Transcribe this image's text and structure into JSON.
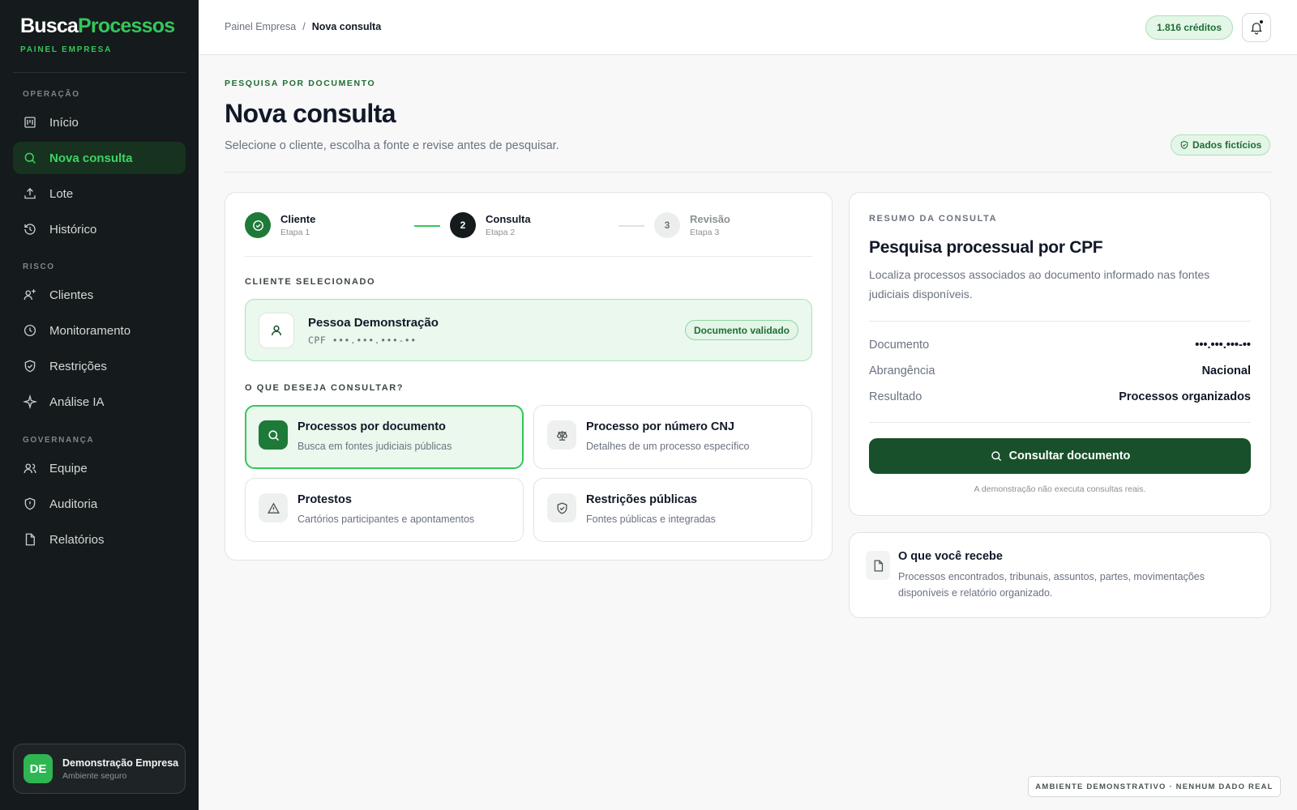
{
  "brand": {
    "part1": "Busca",
    "part2": "Processos",
    "subtitle": "PAINEL EMPRESA"
  },
  "sidebar": {
    "sections": [
      {
        "label": "OPERAÇÃO"
      },
      {
        "label": "RISCO"
      },
      {
        "label": "GOVERNANÇA"
      }
    ],
    "items": [
      {
        "label": "Início",
        "icon": "home-icon"
      },
      {
        "label": "Nova consulta",
        "icon": "search-icon",
        "active": true
      },
      {
        "label": "Lote",
        "icon": "upload-icon"
      },
      {
        "label": "Histórico",
        "icon": "history-icon"
      },
      {
        "label": "Clientes",
        "icon": "user-plus-icon"
      },
      {
        "label": "Monitoramento",
        "icon": "clock-icon"
      },
      {
        "label": "Restrições",
        "icon": "shield-icon"
      },
      {
        "label": "Análise IA",
        "icon": "sparkle-icon"
      },
      {
        "label": "Equipe",
        "icon": "users-icon"
      },
      {
        "label": "Auditoria",
        "icon": "shield-alert-icon"
      },
      {
        "label": "Relatórios",
        "icon": "file-icon"
      }
    ],
    "company": {
      "initials": "DE",
      "name": "Demonstração Empresa",
      "sub": "Ambiente seguro"
    }
  },
  "topbar": {
    "breadcrumb": [
      "Painel Empresa",
      "/",
      "Nova consulta"
    ],
    "credits": "1.816 créditos"
  },
  "header": {
    "eyebrow": "PESQUISA POR DOCUMENTO",
    "title": "Nova consulta",
    "subtitle": "Selecione o cliente, escolha a fonte e revise antes de pesquisar.",
    "badge": "Dados fictícios"
  },
  "steps": [
    {
      "name": "Cliente",
      "sub": "Etapa 1",
      "number": "",
      "state": "done"
    },
    {
      "name": "Consulta",
      "sub": "Etapa 2",
      "number": "2",
      "state": "current"
    },
    {
      "name": "Revisão",
      "sub": "Etapa 3",
      "number": "3",
      "state": "pending"
    }
  ],
  "client": {
    "section_label": "CLIENTE SELECIONADO",
    "name": "Pessoa Demonstração",
    "doc": "CPF •••.•••.•••-••",
    "status": "Documento validado"
  },
  "options": {
    "section_label": "O QUE DESEJA CONSULTAR?",
    "items": [
      {
        "title": "Processos por documento",
        "sub": "Busca em fontes judiciais públicas",
        "icon": "search-icon",
        "selected": true
      },
      {
        "title": "Processo por número CNJ",
        "sub": "Detalhes de um processo específico",
        "icon": "scale-icon"
      },
      {
        "title": "Protestos",
        "sub": "Cartórios participantes e apontamentos",
        "icon": "alert-triangle-icon"
      },
      {
        "title": "Restrições públicas",
        "sub": "Fontes públicas e integradas",
        "icon": "shield-check-icon"
      }
    ]
  },
  "summary": {
    "eyebrow": "RESUMO DA CONSULTA",
    "title": "Pesquisa processual por CPF",
    "desc": "Localiza processos associados ao documento informado nas fontes judiciais disponíveis.",
    "rows": [
      {
        "k": "Documento",
        "v": "•••.•••.•••-••"
      },
      {
        "k": "Abrangência",
        "v": "Nacional"
      },
      {
        "k": "Resultado",
        "v": "Processos organizados"
      }
    ],
    "button": "Consultar documento",
    "note": "A demonstração não executa consultas reais."
  },
  "info": {
    "title": "O que você recebe",
    "desc": "Processos encontrados, tribunais, assuntos, partes, movimentações disponíveis e relatório organizado."
  },
  "footer": {
    "badge": "AMBIENTE DEMONSTRATIVO · NENHUM DADO REAL"
  },
  "colors": {
    "accent": "#34c75a",
    "dark_green": "#17502a",
    "sidebar_bg": "#151a1c"
  }
}
